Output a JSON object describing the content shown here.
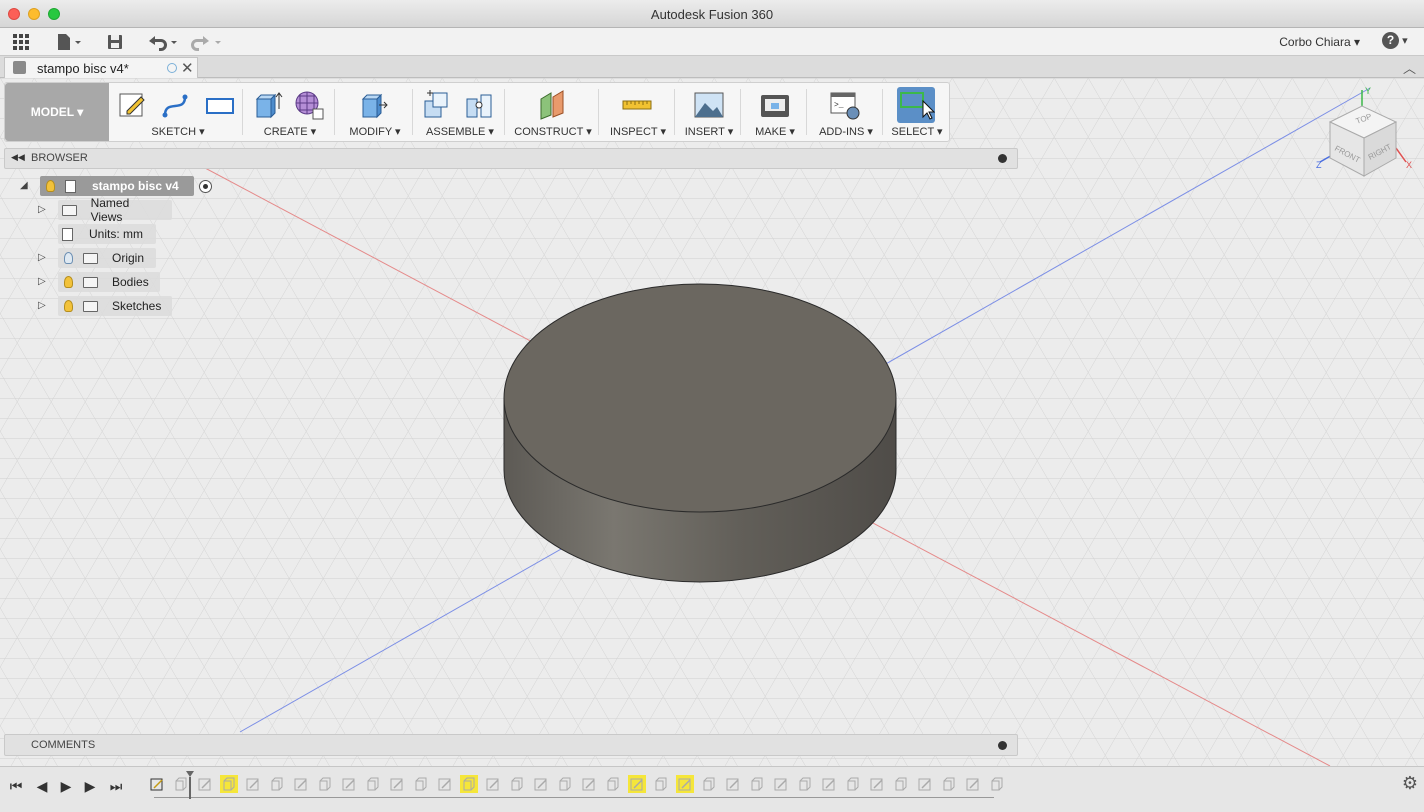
{
  "window": {
    "title": "Autodesk Fusion 360"
  },
  "app_toolbar": {
    "user_name": "Corbo Chiara",
    "user_caret": "▾",
    "help_label": "?"
  },
  "document_tab": {
    "label": "stampo bisc v4*"
  },
  "ribbon": {
    "workspace": "MODEL ▾",
    "groups": [
      {
        "label": "SKETCH ▾"
      },
      {
        "label": "CREATE ▾"
      },
      {
        "label": "MODIFY ▾"
      },
      {
        "label": "ASSEMBLE ▾"
      },
      {
        "label": "CONSTRUCT ▾"
      },
      {
        "label": "INSPECT ▾"
      },
      {
        "label": "INSERT ▾"
      },
      {
        "label": "MAKE ▾"
      },
      {
        "label": "ADD-INS ▾"
      },
      {
        "label": "SELECT ▾"
      }
    ]
  },
  "browser": {
    "title": "BROWSER",
    "root": "stampo bisc v4",
    "items": [
      {
        "label": "Named Views"
      },
      {
        "label": "Units: mm"
      },
      {
        "label": "Origin"
      },
      {
        "label": "Bodies"
      },
      {
        "label": "Sketches"
      }
    ]
  },
  "comments": {
    "title": "COMMENTS"
  },
  "viewcube": {
    "top": "TOP",
    "front": "FRONT",
    "right": "RIGHT",
    "x": "X",
    "y": "Y",
    "z": "Z"
  },
  "colors": {
    "accent": "#5b8fc7",
    "timeline_highlight": "#f5e63a",
    "axis_red": "#e58a8a",
    "axis_blue": "#7c8fe6",
    "body": "#6b6760"
  },
  "timeline": {
    "icons": [
      "sketch-icon",
      "extrude-icon",
      "sketch-icon",
      "extrude-icon",
      "sketch-icon",
      "extrude-icon",
      "sketch-icon",
      "extrude-icon",
      "sketch-icon",
      "extrude-icon",
      "sketch-icon",
      "extrude-icon",
      "sketch-icon",
      "extrude-icon",
      "sketch-icon",
      "extrude-icon",
      "sketch-icon",
      "extrude-icon",
      "sketch-icon",
      "extrude-icon",
      "sketch-icon",
      "extrude-icon",
      "sketch-icon",
      "extrude-icon",
      "sketch-icon",
      "extrude-icon",
      "sketch-icon",
      "extrude-icon",
      "sketch-icon",
      "extrude-icon",
      "sketch-icon",
      "extrude-icon",
      "sketch-icon",
      "extrude-icon",
      "sketch-icon",
      "extrude-icon"
    ],
    "highlighted": [
      3,
      13,
      20,
      22
    ]
  }
}
